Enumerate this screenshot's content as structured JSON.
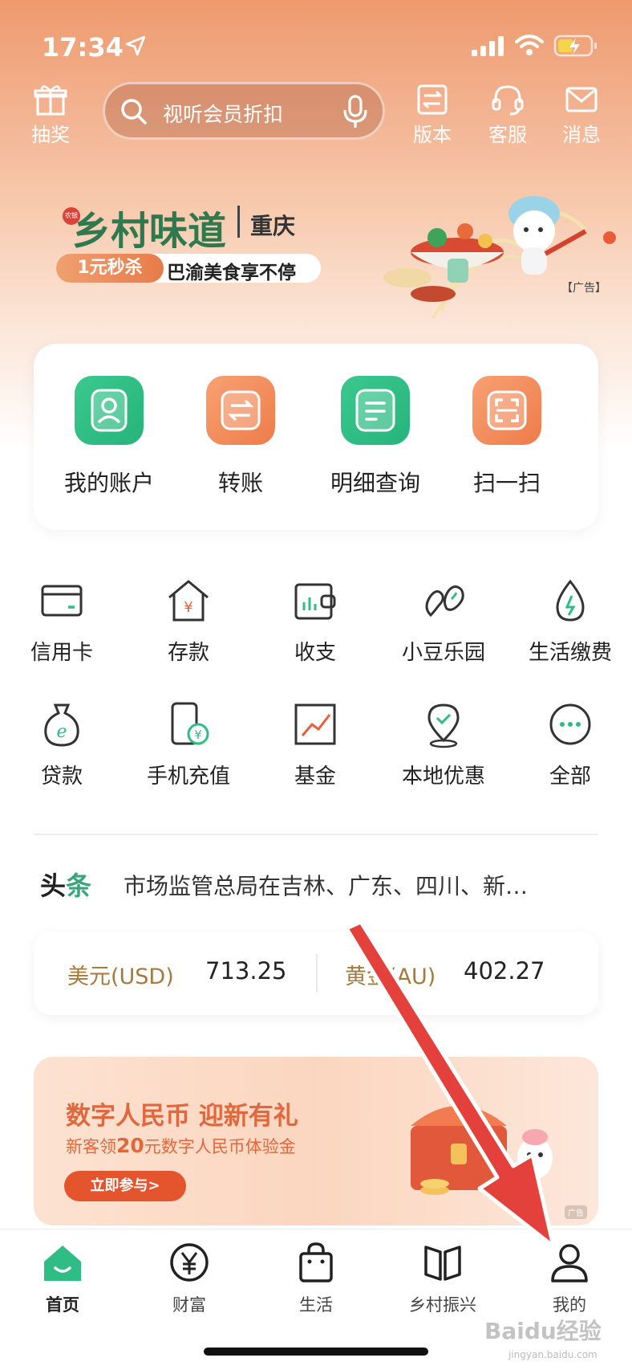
{
  "status_bar": {
    "time": "17:34"
  },
  "header": {
    "lottery_label": "抽奖",
    "search_placeholder": "视听会员折扣",
    "version_label": "版本",
    "service_label": "客服",
    "message_label": "消息"
  },
  "banner": {
    "seal": "农银",
    "title": "乡村味道",
    "city": "重庆",
    "tag": "1元秒杀",
    "subtitle": "巴渝美食享不停",
    "ad_label": "【广告】"
  },
  "quick_actions": [
    {
      "label": "我的账户",
      "icon": "account-icon",
      "color": "#2fbd85"
    },
    {
      "label": "转账",
      "icon": "transfer-icon",
      "color": "#f28a5b"
    },
    {
      "label": "明细查询",
      "icon": "details-icon",
      "color": "#2fbd85"
    },
    {
      "label": "扫一扫",
      "icon": "scan-icon",
      "color": "#f28a5b"
    }
  ],
  "services": [
    {
      "label": "信用卡",
      "icon": "credit-card-icon"
    },
    {
      "label": "存款",
      "icon": "deposit-icon"
    },
    {
      "label": "收支",
      "icon": "wallet-icon"
    },
    {
      "label": "小豆乐园",
      "icon": "beans-icon"
    },
    {
      "label": "生活缴费",
      "icon": "utility-icon"
    },
    {
      "label": "贷款",
      "icon": "loan-icon"
    },
    {
      "label": "手机充值",
      "icon": "phone-topup-icon"
    },
    {
      "label": "基金",
      "icon": "fund-icon"
    },
    {
      "label": "本地优惠",
      "icon": "location-icon"
    },
    {
      "label": "全部",
      "icon": "more-icon"
    }
  ],
  "news": {
    "tag_a": "头",
    "tag_b": "条",
    "text": "市场监管总局在吉林、广东、四川、新…"
  },
  "rates": {
    "usd_label": "美元(USD)",
    "usd_value": "713.25",
    "gold_label": "黄金(AU)",
    "gold_value": "402.27"
  },
  "promo": {
    "title": "数字人民币 迎新有礼",
    "sub_pre": "新客领",
    "sub_amount": "20",
    "sub_post": "元数字人民币体验金",
    "cta": "立即参与>",
    "ad_label": "广告"
  },
  "tabs": [
    {
      "label": "首页",
      "icon": "home-icon",
      "active": true
    },
    {
      "label": "财富",
      "icon": "yen-icon",
      "active": false
    },
    {
      "label": "生活",
      "icon": "bag-icon",
      "active": false
    },
    {
      "label": "乡村振兴",
      "icon": "book-icon",
      "active": false
    },
    {
      "label": "我的",
      "icon": "user-icon",
      "active": false
    }
  ],
  "watermark": {
    "main": "Baidu经验",
    "url": "jingyan.baidu.com"
  },
  "colors": {
    "brand_green": "#2fbd85",
    "brand_orange": "#f28a5b",
    "arrow_red": "#e4403c",
    "rate_label": "#a57a3a"
  }
}
